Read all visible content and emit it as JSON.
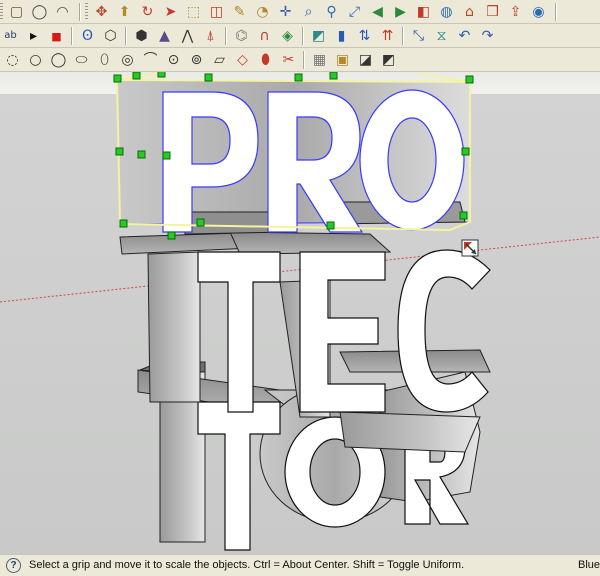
{
  "toolbars": {
    "row1": [
      {
        "name": "square-icon",
        "glyph": "▢",
        "color": "#6a5a2a"
      },
      {
        "name": "circle-icon",
        "glyph": "◯",
        "color": "#444"
      },
      {
        "name": "arc-icon",
        "glyph": "◠",
        "color": "#444"
      }
    ],
    "row1b": [
      {
        "name": "move-icon",
        "glyph": "✥",
        "color": "#b5452b"
      },
      {
        "name": "push-pull-icon",
        "glyph": "⬆",
        "color": "#b58a2b"
      },
      {
        "name": "rotate-icon",
        "glyph": "↻",
        "color": "#c23a2a"
      },
      {
        "name": "follow-me-icon",
        "glyph": "➤",
        "color": "#c23a2a"
      },
      {
        "name": "scale-icon",
        "glyph": "⬚",
        "color": "#b08a2a"
      },
      {
        "name": "offset-icon",
        "glyph": "◫",
        "color": "#c23a2a"
      },
      {
        "name": "tape-measure-icon",
        "glyph": "✎",
        "color": "#b08a2a"
      },
      {
        "name": "protractor-icon",
        "glyph": "◔",
        "color": "#b08a2a"
      },
      {
        "name": "axes-icon",
        "glyph": "✛",
        "color": "#3a5db5"
      },
      {
        "name": "search-icon",
        "glyph": "⌕",
        "color": "#2a6ab5"
      },
      {
        "name": "zoom-window-icon",
        "glyph": "⚲",
        "color": "#2a6ab5"
      },
      {
        "name": "zoom-extents-icon",
        "glyph": "⤢",
        "color": "#2a6ab5"
      },
      {
        "name": "previous-view-icon",
        "glyph": "◀",
        "color": "#2a8a3a"
      },
      {
        "name": "next-view-icon",
        "glyph": "▶",
        "color": "#2a8a3a"
      },
      {
        "name": "section-plane-icon",
        "glyph": "◧",
        "color": "#c23a2a"
      },
      {
        "name": "globe-icon",
        "glyph": "◍",
        "color": "#2a6ab5"
      },
      {
        "name": "house-icon",
        "glyph": "⌂",
        "color": "#b5452b"
      },
      {
        "name": "components-icon",
        "glyph": "❒",
        "color": "#b5452b"
      },
      {
        "name": "share-icon",
        "glyph": "⇪",
        "color": "#b5452b"
      },
      {
        "name": "camera-icon",
        "glyph": "◉",
        "color": "#2a6ab5"
      },
      {
        "name": "layers-icon",
        "glyph": "≣",
        "color": "#5a4a8a"
      },
      {
        "name": "styles-icon",
        "glyph": "◐",
        "color": "#2a8a3a"
      }
    ],
    "row2": [
      {
        "name": "text-tool-icon",
        "glyph": "ab",
        "color": "#1f3f6b"
      },
      {
        "name": "play-icon",
        "glyph": "▸",
        "color": "#111"
      },
      {
        "name": "stop-icon",
        "glyph": "■",
        "color": "#d51a1a"
      },
      {
        "name": "plugin-s-icon",
        "glyph": "Ꙩ",
        "color": "#2a5ab5"
      },
      {
        "name": "x-ray-icon",
        "glyph": "⬡",
        "color": "#333"
      },
      {
        "name": "wireframe-icon",
        "glyph": "⬢",
        "color": "#333"
      },
      {
        "name": "triangle-icon",
        "glyph": "▲",
        "color": "#5a4a8a"
      },
      {
        "name": "fold-icon",
        "glyph": "⋀",
        "color": "#333"
      },
      {
        "name": "extrude-icon",
        "glyph": "⍋",
        "color": "#c23a2a"
      },
      {
        "name": "curtain-icon",
        "glyph": "⌬",
        "color": "#777"
      },
      {
        "name": "magnet-icon",
        "glyph": "∩",
        "color": "#c23a2a"
      },
      {
        "name": "surface-icon",
        "glyph": "◈",
        "color": "#2a8a3a"
      },
      {
        "name": "align-icon",
        "glyph": "◩",
        "color": "#2a8a8a"
      },
      {
        "name": "flip-icon",
        "glyph": "▮",
        "color": "#2a5ab5"
      },
      {
        "name": "up-down-arrows-icon",
        "glyph": "⇅",
        "color": "#2a5ab5"
      },
      {
        "name": "red-arrows-icon",
        "glyph": "⇈",
        "color": "#c23a2a"
      },
      {
        "name": "scale-diagonal-icon",
        "glyph": "⤡",
        "color": "#2a5ab5"
      },
      {
        "name": "mirror-icon",
        "glyph": "⧖",
        "color": "#2a8a8a"
      },
      {
        "name": "curved-arrow-icon",
        "glyph": "↶",
        "color": "#2a5ab5"
      },
      {
        "name": "twist-icon",
        "glyph": "↷",
        "color": "#2a5ab5"
      }
    ],
    "row3": [
      {
        "name": "round-corner-icon",
        "glyph": "◌",
        "color": "#333"
      },
      {
        "name": "chamfer-icon",
        "glyph": "○",
        "color": "#333"
      },
      {
        "name": "fillet-icon",
        "glyph": "◯",
        "color": "#333"
      },
      {
        "name": "bevel-icon",
        "glyph": "⬭",
        "color": "#333"
      },
      {
        "name": "loft-icon",
        "glyph": "⬯",
        "color": "#333"
      },
      {
        "name": "sweep-icon",
        "glyph": "◎",
        "color": "#333"
      },
      {
        "name": "path-icon",
        "glyph": "⌒",
        "color": "#333"
      },
      {
        "name": "skin-icon",
        "glyph": "⊙",
        "color": "#333"
      },
      {
        "name": "shell-icon",
        "glyph": "⊚",
        "color": "#333"
      },
      {
        "name": "plane-icon",
        "glyph": "▱",
        "color": "#333"
      },
      {
        "name": "lasso-icon",
        "glyph": "◇",
        "color": "#c23a2a"
      },
      {
        "name": "paint-icon",
        "glyph": "⬮",
        "color": "#c23a2a"
      },
      {
        "name": "cut-icon",
        "glyph": "✂",
        "color": "#c23a2a"
      },
      {
        "name": "grid-icon",
        "glyph": "▦",
        "color": "#777"
      },
      {
        "name": "box-icon",
        "glyph": "▣",
        "color": "#b58a2b"
      },
      {
        "name": "cube-icon",
        "glyph": "◪",
        "color": "#333"
      },
      {
        "name": "cube-alt-icon",
        "glyph": "◩",
        "color": "#333"
      }
    ]
  },
  "scene": {
    "row1_text": "PRO",
    "row2_text": "TEC",
    "row3_text": "TOR",
    "background_sky": "#ecebe8",
    "background_ground": "#cfd0cf",
    "red_axis_color": "#d44545",
    "selection_color": "#3a3aff",
    "grip_color": "#22cc22",
    "bbox_color": "#f3f3a0"
  },
  "statusbar": {
    "help_glyph": "?",
    "message": "Select a grip and move it to scale the objects. Ctrl = About Center. Shift = Toggle Uniform.",
    "measurements_label": "Blue"
  }
}
